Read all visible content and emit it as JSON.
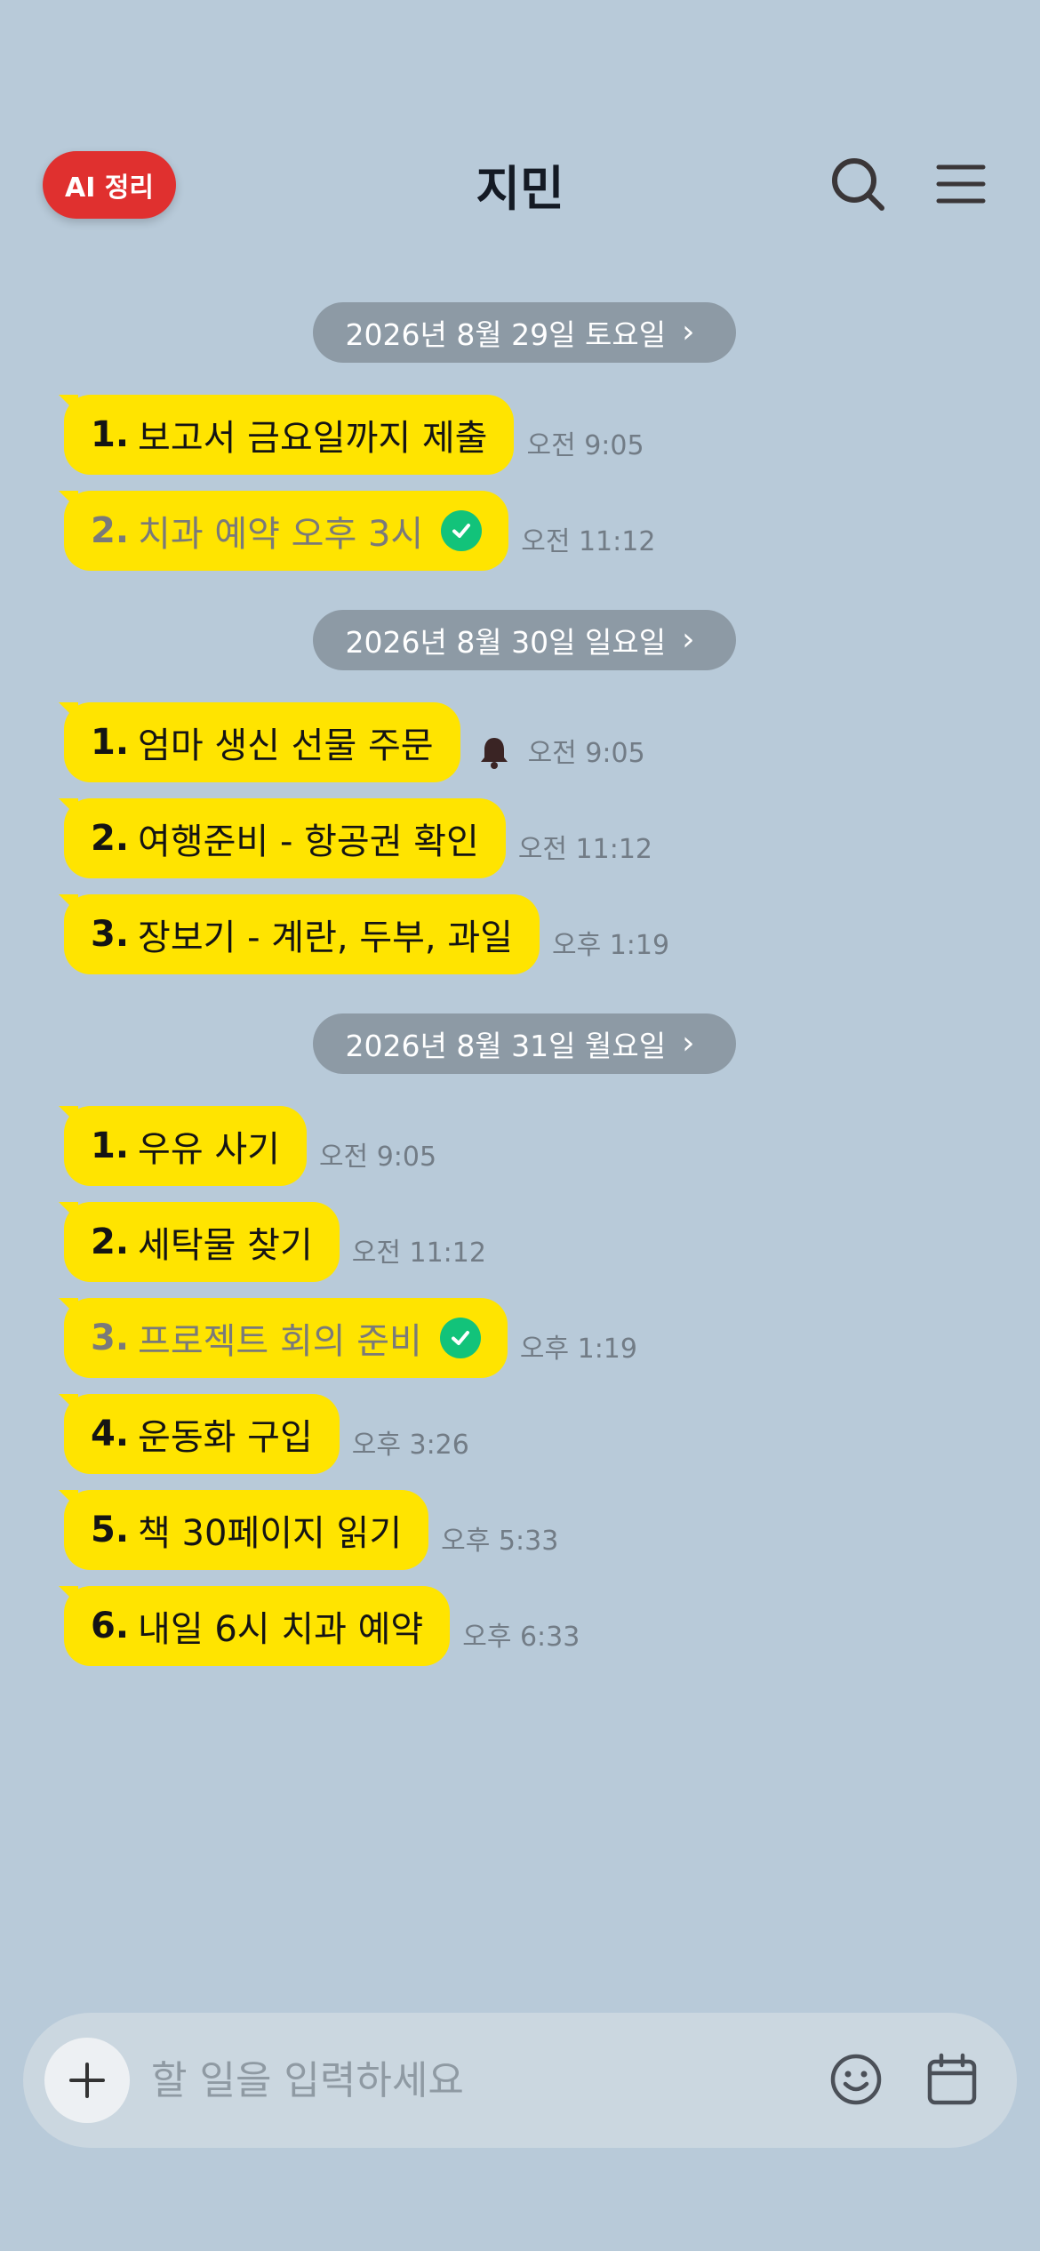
{
  "header": {
    "ai_button_label": "AI 정리",
    "title": "지민",
    "icons": [
      "search-icon",
      "menu-icon"
    ]
  },
  "days": [
    {
      "date": "2026년 8월 29일 토요일",
      "tasks": [
        {
          "num": "1.",
          "text": "보고서 금요일까지 제출",
          "time": "오전 9:05",
          "done": false,
          "bell": false
        },
        {
          "num": "2.",
          "text": "치과 예약 오후 3시",
          "time": "오전 11:12",
          "done": true,
          "bell": false
        }
      ]
    },
    {
      "date": "2026년 8월 30일 일요일",
      "tasks": [
        {
          "num": "1.",
          "text": "엄마 생신 선물 주문",
          "time": "오전 9:05",
          "done": false,
          "bell": true
        },
        {
          "num": "2.",
          "text": "여행준비 - 항공권 확인",
          "time": "오전 11:12",
          "done": false,
          "bell": false
        },
        {
          "num": "3.",
          "text": "장보기 - 계란, 두부, 과일",
          "time": "오후 1:19",
          "done": false,
          "bell": false
        }
      ]
    },
    {
      "date": "2026년 8월 31일 월요일",
      "tasks": [
        {
          "num": "1.",
          "text": "우유 사기",
          "time": "오전 9:05",
          "done": false,
          "bell": false
        },
        {
          "num": "2.",
          "text": "세탁물 찾기",
          "time": "오전 11:12",
          "done": false,
          "bell": false
        },
        {
          "num": "3.",
          "text": "프로젝트 회의 준비",
          "time": "오후 1:19",
          "done": true,
          "bell": false
        },
        {
          "num": "4.",
          "text": "운동화 구입",
          "time": "오후 3:26",
          "done": false,
          "bell": false
        },
        {
          "num": "5.",
          "text": "책 30페이지 읽기",
          "time": "오후 5:33",
          "done": false,
          "bell": false
        },
        {
          "num": "6.",
          "text": "내일 6시 치과 예약",
          "time": "오후 6:33",
          "done": false,
          "bell": false
        }
      ]
    }
  ],
  "input": {
    "placeholder": "할 일을 입력하세요",
    "value": "",
    "icons": [
      "plus-icon",
      "emoji-icon",
      "calendar-icon"
    ]
  },
  "colors": {
    "background": "#b8cad9",
    "bubble": "#ffe400",
    "ai_button": "#e0302f",
    "date_pill": "#8d9aa5",
    "check": "#12c37a"
  }
}
